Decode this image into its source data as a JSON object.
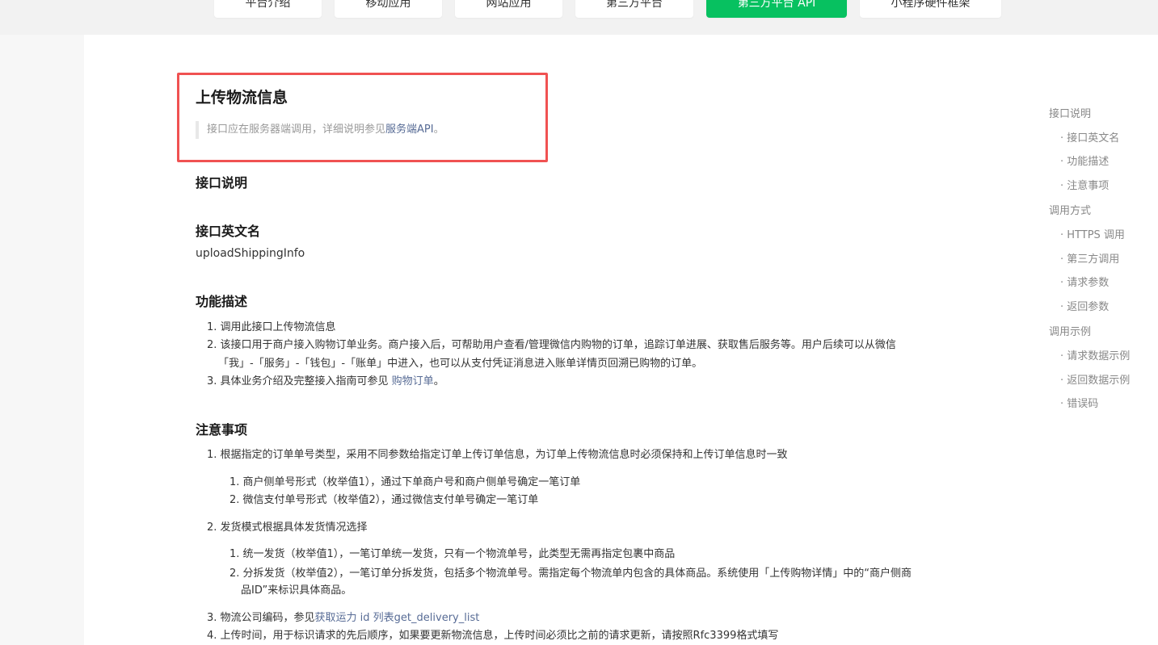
{
  "nav": {
    "tabs": [
      {
        "label": "平台介绍"
      },
      {
        "label": "移动应用"
      },
      {
        "label": "网站应用"
      },
      {
        "label": "第三方平台"
      },
      {
        "label": "第三方平台 API"
      },
      {
        "label": "小程序硬件框架"
      }
    ],
    "active_color": "#07c160"
  },
  "doc": {
    "title": "上传物流信息",
    "tip": {
      "prefix": "接口应在服务器端调用，详细说明参见",
      "link": "服务端API",
      "suffix": "。"
    },
    "s1_heading": "接口说明",
    "s2_heading": "接口英文名",
    "api_name": "uploadShippingInfo",
    "s3_heading": "功能描述",
    "func": {
      "item1": "1. 调用此接口上传物流信息",
      "item2_line1": "2. 该接口用于商户接入购物订单业务。商户接入后，可帮助用户查看/管理微信内购物的订单，追踪订单进展、获取售后服务等。用户后续可以从微信",
      "item2_line2": "「我」-「服务」-「钱包」-「账单」中进入，也可以从支付凭证消息进入账单详情页回溯已购物的订单。",
      "item3_prefix": "3. 具体业务介绍及完整接入指南可参见 ",
      "item3_link": "购物订单",
      "item3_suffix": "。"
    },
    "s4_heading": "注意事项",
    "notes": {
      "n1": "1. 根据指定的订单单号类型，采用不同参数给指定订单上传订单信息，为订单上传物流信息时必须保持和上传订单信息时一致",
      "n1_1": "1. 商户侧单号形式（枚举值1），通过下单商户号和商户侧单号确定一笔订单",
      "n1_2": "2. 微信支付单号形式（枚举值2），通过微信支付单号确定一笔订单",
      "n2": "2. 发货模式根据具体发货情况选择",
      "n2_1": "1. 统一发货（枚举值1），一笔订单统一发货，只有一个物流单号，此类型无需再指定包裹中商品",
      "n2_2_line1": "2. 分拆发货（枚举值2），一笔订单分拆发货，包括多个物流单号。需指定每个物流单内包含的具体商品。系统使用「上传购物详情」中的“商户侧商",
      "n2_2_line2": "品ID”来标识具体商品。",
      "n3_prefix": "3. 物流公司编码，参见",
      "n3_link": "获取运力 id 列表get_delivery_list",
      "n4": "4. 上传时间，用于标识请求的先后顺序，如果要更新物流信息，上传时间必须比之前的请求更新，请按照Rfc3399格式填写"
    },
    "highlight_color": "#f05252",
    "link_color": "#576b95"
  },
  "toc": {
    "items": [
      {
        "label": "接口说明"
      },
      {
        "label": "· 接口英文名"
      },
      {
        "label": "· 功能描述"
      },
      {
        "label": "· 注意事项"
      },
      {
        "label": "调用方式"
      },
      {
        "label": "· HTTPS 调用"
      },
      {
        "label": "· 第三方调用"
      },
      {
        "label": "· 请求参数"
      },
      {
        "label": "· 返回参数"
      },
      {
        "label": "调用示例"
      },
      {
        "label": "· 请求数据示例"
      },
      {
        "label": "· 返回数据示例"
      },
      {
        "label": "· 错误码"
      }
    ]
  }
}
